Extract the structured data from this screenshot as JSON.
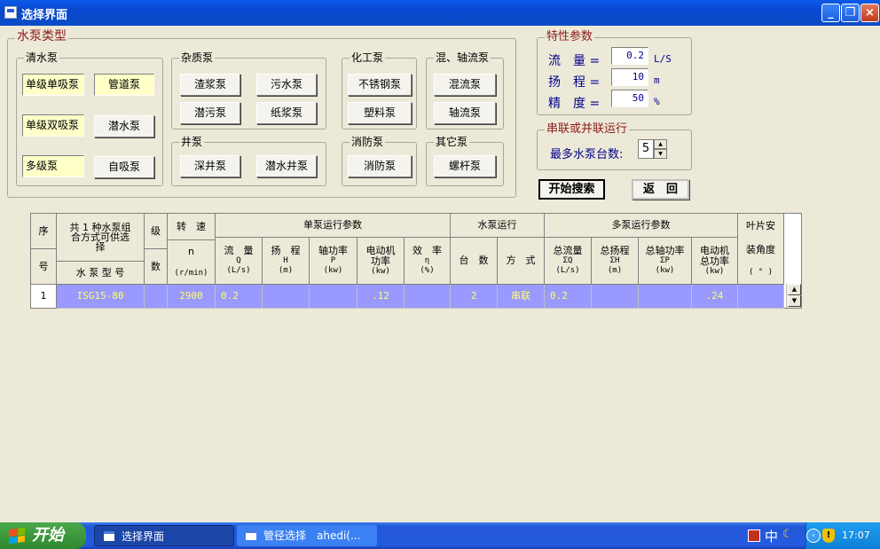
{
  "window": {
    "title": "选择界面",
    "min": "_",
    "max": "❐",
    "close": "×"
  },
  "pump_type": {
    "title": "水泵类型",
    "clean": {
      "title": "清水泵",
      "items": [
        "单级单吸泵",
        "管道泵",
        "单级双吸泵",
        "潜水泵",
        "多级泵",
        "自吸泵"
      ]
    },
    "impurity": {
      "title": "杂质泵",
      "items": [
        "渣浆泵",
        "污水泵",
        "潜污泵",
        "纸浆泵"
      ]
    },
    "chemical": {
      "title": "化工泵",
      "items": [
        "不锈钢泵",
        "塑料泵"
      ]
    },
    "mixed": {
      "title": "混、轴流泵",
      "items": [
        "混流泵",
        "轴流泵"
      ]
    },
    "well": {
      "title": "井泵",
      "items": [
        "深井泵",
        "潜水井泵"
      ]
    },
    "fire": {
      "title": "消防泵",
      "items": [
        "消防泵"
      ]
    },
    "other": {
      "title": "其它泵",
      "items": [
        "螺杆泵"
      ]
    }
  },
  "params": {
    "title": "特性参数",
    "flow": {
      "label": "流　量 =",
      "value": "0.2",
      "unit": "L/S"
    },
    "head": {
      "label": "扬　程 =",
      "value": "10",
      "unit": "m"
    },
    "precision": {
      "label": "精　度 =",
      "value": "50",
      "unit": "%"
    }
  },
  "series": {
    "title": "串联或并联运行",
    "label": "最多水泵台数:",
    "value": "5"
  },
  "buttons": {
    "search": "开始搜索",
    "back": "返　回"
  },
  "table": {
    "h_seq_top": "序",
    "h_seq_bot": "号",
    "h_model_top": "共 1 种水泵组合方式可供选择",
    "h_model_bot": "水 泵 型 号",
    "h_stage_top": "级",
    "h_stage_bot": "数",
    "h_speed_top": "转　速",
    "h_speed_mid": "n",
    "h_speed_bot": "(r/min)",
    "h_single": "单泵运行参数",
    "h_flow": "流　量",
    "h_flow_sym": "Q",
    "h_flow_u": "(L/s)",
    "h_head": "扬　程",
    "h_head_sym": "H",
    "h_head_u": "(m)",
    "h_shaft": "轴功率",
    "h_shaft_sym": "P",
    "h_shaft_u": "(kw)",
    "h_motor": "电动机功率",
    "h_motor_u": "(kw)",
    "h_eff": "效　率",
    "h_eff_sym": "η",
    "h_eff_u": "(%)",
    "h_run": "水泵运行",
    "h_count": "台　数",
    "h_mode": "方　式",
    "h_multi": "多泵运行参数",
    "h_tflow": "总流量",
    "h_tflow_sym": "ΣQ",
    "h_tflow_u": "(L/s)",
    "h_thead": "总扬程",
    "h_thead_sym": "ΣH",
    "h_thead_u": "(m)",
    "h_tshaft": "总轴功率",
    "h_tshaft_sym": "ΣP",
    "h_tshaft_u": "(kw)",
    "h_tmotor": "电动机总功率",
    "h_tmotor_u": "(kw)",
    "h_blade_top": "叶片安",
    "h_blade_mid": "装角度",
    "h_blade_bot": "( ° )",
    "rows": [
      {
        "seq": "1",
        "model": "ISG15-80",
        "stage": "",
        "speed": "2900",
        "flow": "0.2",
        "head": "",
        "shaft": "",
        "motor": ".12",
        "eff": "",
        "count": "2",
        "mode": "串联",
        "tflow": "0.2",
        "thead": "",
        "tshaft": "",
        "tmotor": ".24",
        "blade": ""
      }
    ]
  },
  "taskbar": {
    "start": "开始",
    "tasks": [
      "选择界面",
      "管径选择　ahedi(..."
    ],
    "ime": "中",
    "time": "17:07"
  },
  "colors": {
    "row_bg": "#9999ff",
    "row_text": "#ffff66",
    "label_bg": "#ffffc8",
    "titlebar": "#0a5ae8",
    "group_title": "#8b1a1a",
    "param_text": "#00008b"
  }
}
